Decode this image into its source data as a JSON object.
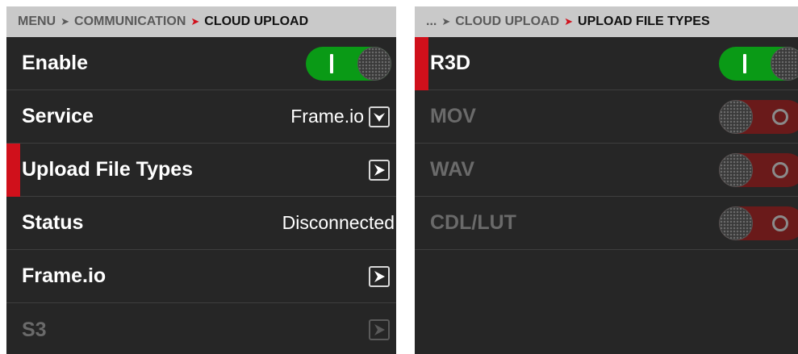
{
  "left_panel": {
    "breadcrumb": {
      "items": [
        "MENU",
        "COMMUNICATION"
      ],
      "current": "CLOUD UPLOAD"
    },
    "rows": {
      "enable": {
        "label": "Enable",
        "toggle_state": "on"
      },
      "service": {
        "label": "Service",
        "value": "Frame.io"
      },
      "upload_file_types": {
        "label": "Upload File Types"
      },
      "status": {
        "label": "Status",
        "value": "Disconnected"
      },
      "frameio": {
        "label": "Frame.io"
      },
      "s3": {
        "label": "S3"
      }
    }
  },
  "right_panel": {
    "breadcrumb": {
      "items": [
        "...",
        "CLOUD UPLOAD"
      ],
      "current": "UPLOAD FILE TYPES"
    },
    "rows": {
      "r3d": {
        "label": "R3D",
        "toggle_state": "on"
      },
      "mov": {
        "label": "MOV",
        "toggle_state": "off"
      },
      "wav": {
        "label": "WAV",
        "toggle_state": "off"
      },
      "cdl_lut": {
        "label": "CDL/LUT",
        "toggle_state": "off"
      }
    }
  },
  "icons": {
    "separator": "chevron-right-icon",
    "dropdown": "dropdown-arrow-icon",
    "submenu": "submenu-arrow-icon"
  },
  "colors": {
    "accent_red": "#d0101b",
    "toggle_on": "#0a9a16",
    "toggle_off": "#6a1a1a",
    "panel_bg": "#262626",
    "header_bg": "#c9c9c9"
  }
}
